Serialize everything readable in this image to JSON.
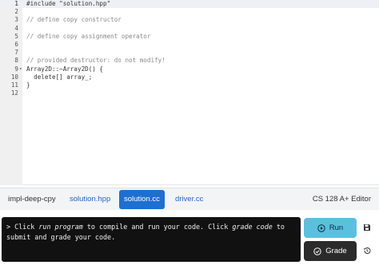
{
  "editor": {
    "lines": [
      {
        "num": "1",
        "text": "#include \"solution.hpp\"",
        "fold": ""
      },
      {
        "num": "2",
        "text": "",
        "fold": ""
      },
      {
        "num": "3",
        "text": "// define copy constructor",
        "fold": ""
      },
      {
        "num": "4",
        "text": "",
        "fold": ""
      },
      {
        "num": "5",
        "text": "// define copy assignment operator",
        "fold": ""
      },
      {
        "num": "6",
        "text": "",
        "fold": ""
      },
      {
        "num": "7",
        "text": "",
        "fold": ""
      },
      {
        "num": "8",
        "text": "// provided destructor: do not modify!",
        "fold": ""
      },
      {
        "num": "9",
        "text": "Array2D::~Array2D() {",
        "fold": "▾"
      },
      {
        "num": "10",
        "text": "  delete[] array_;",
        "fold": ""
      },
      {
        "num": "11",
        "text": "}",
        "fold": ""
      },
      {
        "num": "12",
        "text": "",
        "fold": ""
      }
    ],
    "active_line": "1"
  },
  "tabs": [
    {
      "label": "impl-deep-cpy",
      "style": "plain"
    },
    {
      "label": "solution.hpp",
      "style": "link"
    },
    {
      "label": "solution.cc",
      "style": "active"
    },
    {
      "label": "driver.cc",
      "style": "link"
    }
  ],
  "editor_label": "CS 128 A+ Editor",
  "console": {
    "prompt": "> ",
    "part1": "Click ",
    "run_em": "run program",
    "part2": " to compile and run your code. Click ",
    "grade_em": "grade code",
    "part3": " to submit and grade your code."
  },
  "buttons": {
    "run_label": "Run",
    "grade_label": "Grade"
  },
  "icons": {
    "run": "play-circle-icon",
    "grade": "check-circle-icon",
    "save": "save-icon",
    "history": "history-icon"
  },
  "colors": {
    "active_tab": "#1d6fd1",
    "run_button": "#5bc0de",
    "grade_button": "#2b2b2b",
    "console_bg": "#111111"
  }
}
